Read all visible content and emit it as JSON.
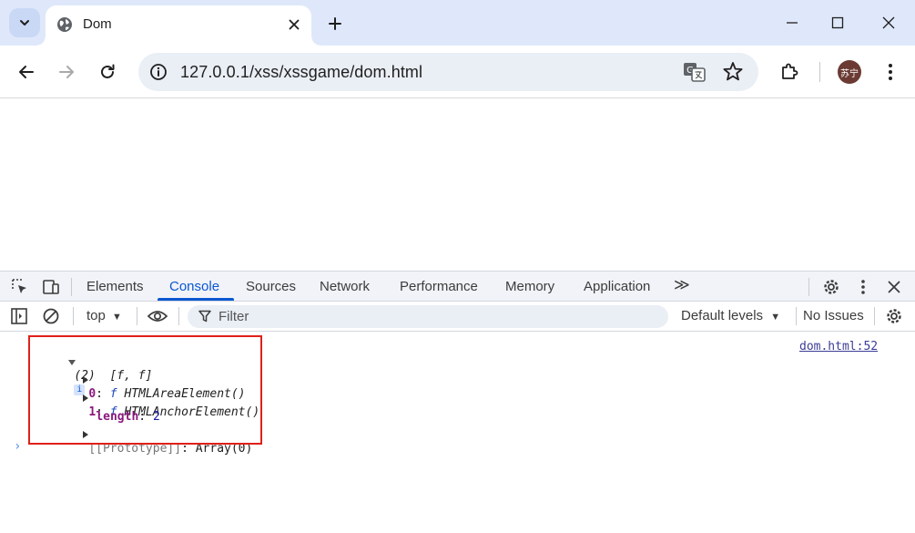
{
  "browser": {
    "tab_title": "Dom",
    "url": "127.0.0.1/xss/xssgame/dom.html",
    "avatar_text": "苏宁"
  },
  "devtools": {
    "tabs": [
      {
        "label": "Elements"
      },
      {
        "label": "Console"
      },
      {
        "label": "Sources"
      },
      {
        "label": "Network"
      },
      {
        "label": "Performance"
      },
      {
        "label": "Memory"
      },
      {
        "label": "Application"
      }
    ],
    "active_tab": "Console",
    "more_tabs": "≫",
    "context": "top",
    "filter_placeholder": "Filter",
    "levels": "Default levels",
    "issues": "No Issues"
  },
  "console": {
    "source_link": "dom.html:52",
    "summary": "(2)  [f, f]",
    "entries": [
      {
        "key": "0",
        "prefix": "f",
        "value": "HTMLAreaElement()"
      },
      {
        "key": "1",
        "prefix": "f",
        "value": "HTMLAnchorElement()"
      }
    ],
    "length_key": "length",
    "length_value": "2",
    "prototype_label": "[[Prototype]]",
    "prototype_value": "Array(0)"
  },
  "colors": {
    "tabstrip": "#dfe8fa",
    "accent": "#0b57d0",
    "highlight": "#e0201a"
  }
}
